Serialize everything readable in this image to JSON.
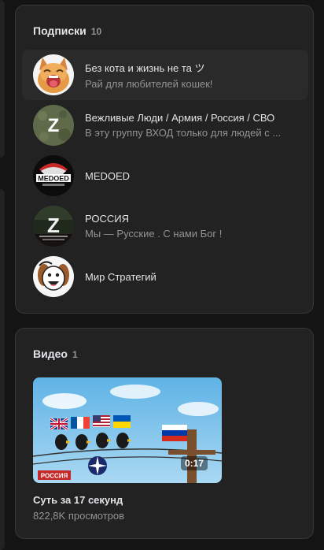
{
  "subscriptions": {
    "title": "Подписки",
    "count": "10",
    "items": [
      {
        "name": "Без кота и жизнь не та ツ",
        "desc": "Рай для любителей кошек!",
        "avatar_icon": "cat-avatar-icon"
      },
      {
        "name": "Вежливые Люди / Армия / Россия / СВО",
        "desc": "В эту группу ВХОД только для людей с ...",
        "avatar_icon": "z-avatar-icon"
      },
      {
        "name": "MEDOED",
        "desc": "",
        "avatar_icon": "medoed-avatar-icon",
        "avatar_text": "MEDOED"
      },
      {
        "name": "РОССИЯ",
        "desc": "Мы — Русские . С нами Бог !",
        "avatar_icon": "z-flag-avatar-icon"
      },
      {
        "name": "Мир Стратегий",
        "desc": "",
        "avatar_icon": "cartoon-dog-avatar-icon"
      }
    ]
  },
  "videos": {
    "title": "Видео",
    "count": "1",
    "items": [
      {
        "title": "Суть за 17 секунд",
        "views": "822,8K просмотров",
        "duration": "0:17",
        "thumb_icon": "birds-flags-thumbnail",
        "thumb_caption": "РОССИЯ"
      }
    ]
  },
  "colors": {
    "background": "#141414",
    "card": "#222222",
    "text_primary": "#e1e3e6",
    "text_secondary": "#939393"
  }
}
